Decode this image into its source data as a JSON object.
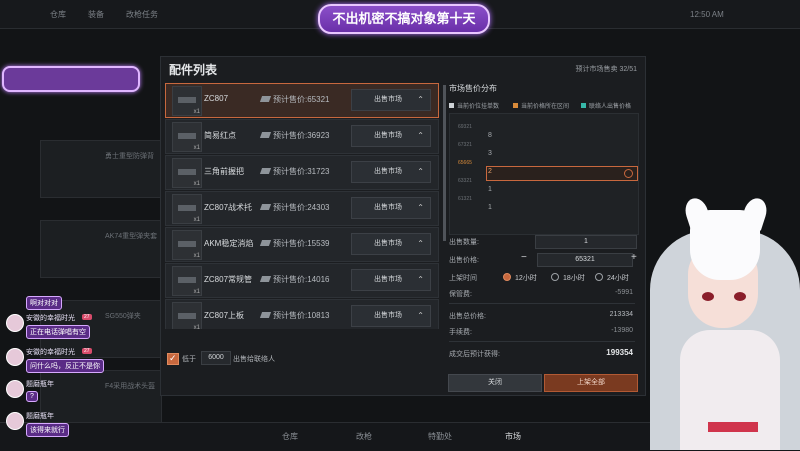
{
  "stream": {
    "title": "不出机密不搞对象第十天",
    "watermark_time": "12:50 AM"
  },
  "background": {
    "top_tabs": [
      "仓库",
      "装备",
      "改枪任务"
    ],
    "cards": [
      "勇士重型防弹背",
      "AK74重型弹夹套",
      "SG550弹夹",
      "F4采用战术头盔"
    ],
    "bottom_tabs": [
      "仓库",
      "改枪",
      "特勤处",
      "市场"
    ],
    "bottom_active": "市场"
  },
  "dialog": {
    "title": "配件列表",
    "count": "预计市场售卖 32/51",
    "items": [
      {
        "name": "ZC807",
        "price_label": "预计售价:65321",
        "sell": "出售市场",
        "qty": "x1",
        "selected": true
      },
      {
        "name": "简易红点",
        "price_label": "预计售价:36923",
        "sell": "出售市场",
        "qty": "x1",
        "selected": false
      },
      {
        "name": "三角前握把",
        "price_label": "预计售价:31723",
        "sell": "出售市场",
        "qty": "x1",
        "selected": false
      },
      {
        "name": "ZC807战术托",
        "price_label": "预计售价:24303",
        "sell": "出售市场",
        "qty": "x1",
        "selected": false
      },
      {
        "name": "AKM稳定消焰",
        "price_label": "预计售价:15539",
        "sell": "出售市场",
        "qty": "x1",
        "selected": false
      },
      {
        "name": "ZC807常规管",
        "price_label": "预计售价:14016",
        "sell": "出售市场",
        "qty": "x1",
        "selected": false
      },
      {
        "name": "ZC807上板",
        "price_label": "预计售价:10813",
        "sell": "出售市场",
        "qty": "x1",
        "selected": false
      }
    ],
    "footer": {
      "checked": true,
      "lower_label": "低于",
      "threshold": "6000",
      "suffix": "出售给联络人"
    }
  },
  "market": {
    "title": "市场售价分布",
    "legend": [
      {
        "label": "当前价位挂单数",
        "color": "#cfd3d7"
      },
      {
        "label": "当前价格所在区间",
        "color": "#d98b3a"
      },
      {
        "label": "联络人出售价格",
        "color": "#37b8a9"
      }
    ],
    "rows": [
      {
        "price": "69321",
        "qty": "8"
      },
      {
        "price": "67321",
        "qty": "3"
      },
      {
        "price": "65665",
        "qty": "2"
      },
      {
        "price": "63321",
        "qty": "1"
      },
      {
        "price": "61321",
        "qty": "1"
      }
    ],
    "qty_label": "出售数量:",
    "qty_value": "1",
    "price_label": "出售价格:",
    "price_value": "65321",
    "minus": "−",
    "plus": "+",
    "duration_label": "上架时间",
    "durations": [
      {
        "label": "12小时",
        "on": true
      },
      {
        "label": "18小时",
        "on": false
      },
      {
        "label": "24小时",
        "on": false
      }
    ],
    "custody_label": "保管费:",
    "custody_value": "-5991",
    "total_label": "出售总价格:",
    "total_value": "213334",
    "fee_label": "手续费:",
    "fee_value": "-13980",
    "expected_label": "成交后预计获得:",
    "expected_value": "199354",
    "close_btn": "关闭",
    "sell_btn": "上架全部"
  },
  "chat": [
    {
      "name": "",
      "msg": "啊对对对"
    },
    {
      "name": "安徽的幸福时光",
      "badge": "27",
      "msg": "正在电话弹唱有空"
    },
    {
      "name": "安徽的幸福时光",
      "badge": "27",
      "msg": "问什么吗，反正不是你"
    },
    {
      "name": "题磨瓶年",
      "badge": "",
      "msg": "?"
    },
    {
      "name": "题磨瓶年",
      "badge": "",
      "msg": "该得来就行"
    }
  ]
}
